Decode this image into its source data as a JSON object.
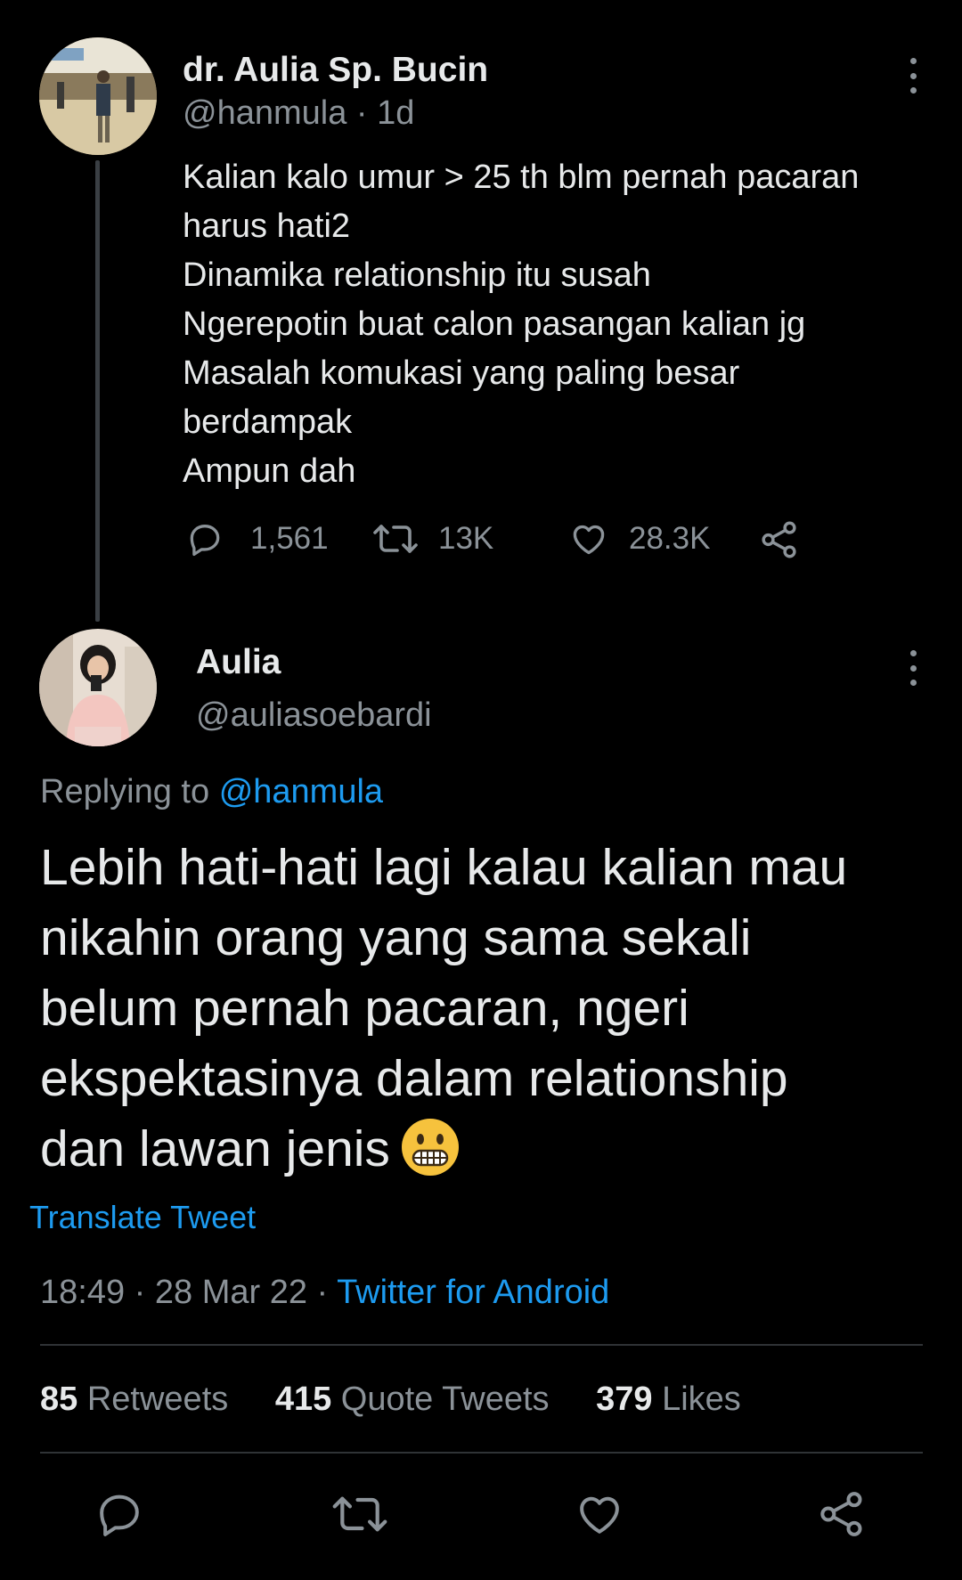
{
  "original_tweet": {
    "display_name": "dr. Aulia Sp. Bucin",
    "handle": "@hanmula",
    "time_ago": "· 1d",
    "text_lines": [
      "Kalian kalo umur > 25 th blm pernah pacaran",
      "harus hati2",
      "Dinamika relationship itu susah",
      "Ngerepotin buat calon pasangan kalian jg",
      "Masalah komukasi yang paling besar",
      "berdampak",
      "Ampun dah"
    ],
    "replies": "1,561",
    "retweets": "13K",
    "likes": "28.3K"
  },
  "reply_tweet": {
    "display_name": "Aulia",
    "handle": "@auliasoebardi",
    "replying_label": "Replying to",
    "replying_to": "@hanmula",
    "text_lines": [
      "Lebih hati-hati lagi kalau kalian mau",
      "nikahin orang yang sama sekali",
      "belum pernah pacaran, ngeri",
      "ekspektasinya dalam relationship",
      "dan lawan jenis"
    ],
    "emoji": "grimacing-face",
    "translate_label": "Translate Tweet",
    "time": "18:49",
    "date": "28 Mar 22",
    "source": "Twitter for Android",
    "stats": {
      "retweets_count": "85",
      "retweets_label": "Retweets",
      "quotes_count": "415",
      "quotes_label": "Quote Tweets",
      "likes_count": "379",
      "likes_label": "Likes"
    }
  },
  "icons": [
    "reply-icon",
    "retweet-icon",
    "like-icon",
    "share-icon",
    "more-icon"
  ],
  "colors": {
    "background": "#000000",
    "text_primary": "#e7e9ea",
    "text_secondary": "#8b9298",
    "accent": "#1d9bf0",
    "divider": "#2f3336"
  }
}
